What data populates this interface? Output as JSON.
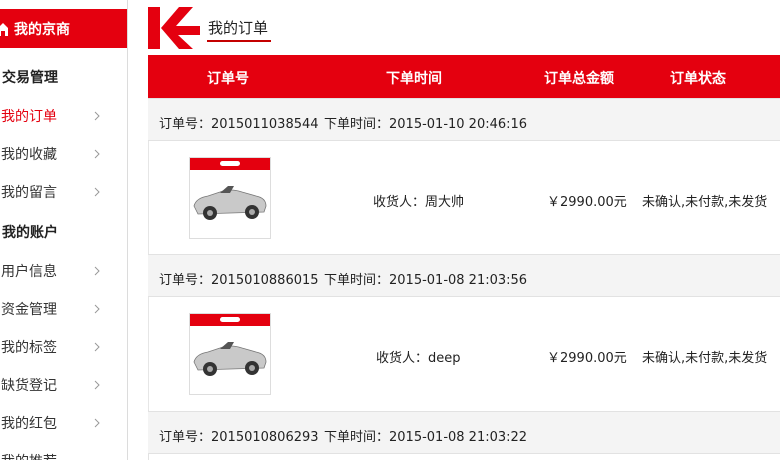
{
  "sidebar": {
    "header": "我的京商",
    "groups": [
      "交易管理",
      "我的账户"
    ],
    "items": [
      {
        "label": "我的订单"
      },
      {
        "label": "我的收藏"
      },
      {
        "label": "我的留言"
      },
      {
        "label": "用户信息"
      },
      {
        "label": "资金管理"
      },
      {
        "label": "我的标签"
      },
      {
        "label": "缺货登记"
      },
      {
        "label": "我的红包"
      },
      {
        "label": "我的推荐"
      }
    ]
  },
  "header": {
    "title": "我的订单"
  },
  "table": {
    "columns": [
      "订单号",
      "下单时间",
      "订单总金额",
      "订单状态"
    ]
  },
  "orders": [
    {
      "number": "订单号：2015011038544",
      "time": "下单时间：2015-01-10 20:46:16",
      "receiver": "收货人：周大帅",
      "amount": "￥2990.00元",
      "status": "未确认,未付款,未发货"
    },
    {
      "number": "订单号：2015010886015",
      "time": "下单时间：2015-01-08 21:03:56",
      "receiver": "收货人：deep",
      "amount": "￥2990.00元",
      "status": "未确认,未付款,未发货"
    },
    {
      "number": "订单号：2015010806293",
      "time": "下单时间：2015-01-08 21:03:22"
    }
  ],
  "colors": {
    "accent": "#e4000f",
    "row_bg": "#f4f4f4"
  }
}
